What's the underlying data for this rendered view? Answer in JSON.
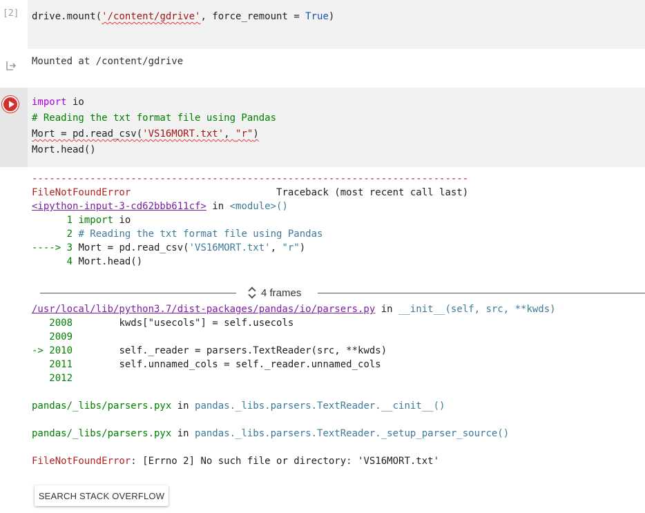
{
  "cell1": {
    "exec_count": "[2]",
    "code": {
      "p1": "drive.mount(",
      "s1": "'/content/gdrive'",
      "p2": ", force_remount = ",
      "kw1": "True",
      "p3": ")"
    }
  },
  "output1": {
    "icon": "output-redirect-icon",
    "text": "Mounted at /content/gdrive"
  },
  "cell2": {
    "run_icon": "run-cell-icon",
    "lines": {
      "l1_kw": "import",
      "l1_rest": " io",
      "l2": "# Reading the txt format file using Pandas",
      "l3_a": "Mort = pd.read_csv(",
      "l3_s1": "'VS16MORT.txt'",
      "l3_b": ", ",
      "l3_s2": "\"r\"",
      "l3_c": ")",
      "l4": "Mort.head()"
    }
  },
  "traceback": {
    "dashes": "---------------------------------------------------------------------------",
    "error_name": "FileNotFoundError",
    "traceback_label": "Traceback (most recent call last)",
    "input_link": "<ipython-input-3-cd62bbb611cf>",
    "in_word": " in ",
    "module": "<module>()",
    "src_lines": {
      "n1": "      1 ",
      "t1_kw": "import",
      "t1_rest": " io",
      "n2": "      2 ",
      "t2": "# Reading the txt format file using Pandas",
      "n3": "----> 3 ",
      "t3_a": "Mort = pd.read_csv(",
      "t3_s1": "'VS16MORT.txt'",
      "t3_b": ", ",
      "t3_s2": "\"r\"",
      "t3_c": ")",
      "n4": "      4 ",
      "t4": "Mort.head()"
    },
    "frames_label": "4 frames",
    "parsers_link": "/usr/local/lib/python3.7/dist-packages/pandas/io/parsers.py",
    "parsers_fn": "__init__(self, src, **kwds)",
    "parsers_lines": [
      {
        "num": "   2008",
        "code": "        kwds[\"usecols\"] = self.usecols"
      },
      {
        "num": "   2009",
        "code": ""
      },
      {
        "num": "-> 2010",
        "code": "        self._reader = parsers.TextReader(src, **kwds)"
      },
      {
        "num": "   2011",
        "code": "        self.unnamed_cols = self._reader.unnamed_cols"
      },
      {
        "num": "   2012",
        "code": ""
      }
    ],
    "pyx1_file": "pandas/_libs/parsers.pyx",
    "pyx1_fn": "pandas._libs.parsers.TextReader.__cinit__()",
    "pyx2_file": "pandas/_libs/parsers.pyx",
    "pyx2_fn": "pandas._libs.parsers.TextReader._setup_parser_source()",
    "final_error_name": "FileNotFoundError",
    "final_error_msg": ": [Errno 2] No such file or directory: 'VS16MORT.txt'"
  },
  "search_button": "SEARCH STACK OVERFLOW"
}
